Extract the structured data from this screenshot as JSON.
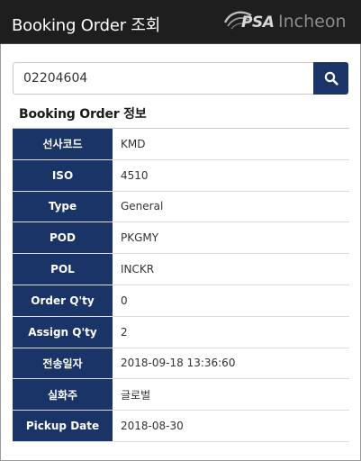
{
  "header": {
    "title": "Booking Order 조회",
    "logo_brand": "PSA",
    "logo_city": "Incheon"
  },
  "search": {
    "value": "02204604",
    "button_icon": "search-icon"
  },
  "section": {
    "title": "Booking Order 정보"
  },
  "details": [
    {
      "label": "선사코드",
      "value": "KMD"
    },
    {
      "label": "ISO",
      "value": "4510"
    },
    {
      "label": "Type",
      "value": "General"
    },
    {
      "label": "POD",
      "value": "PKGMY"
    },
    {
      "label": "POL",
      "value": "INCKR"
    },
    {
      "label": "Order Q'ty",
      "value": "0"
    },
    {
      "label": "Assign Q'ty",
      "value": "2"
    },
    {
      "label": "전송일자",
      "value": "2018-09-18 13:36:60"
    },
    {
      "label": "실화주",
      "value": "글로벌"
    },
    {
      "label": "Pickup Date",
      "value": "2018-08-30"
    }
  ],
  "colors": {
    "header_bg": "#1e1e1e",
    "accent": "#1b3467",
    "border": "#dddddd"
  }
}
